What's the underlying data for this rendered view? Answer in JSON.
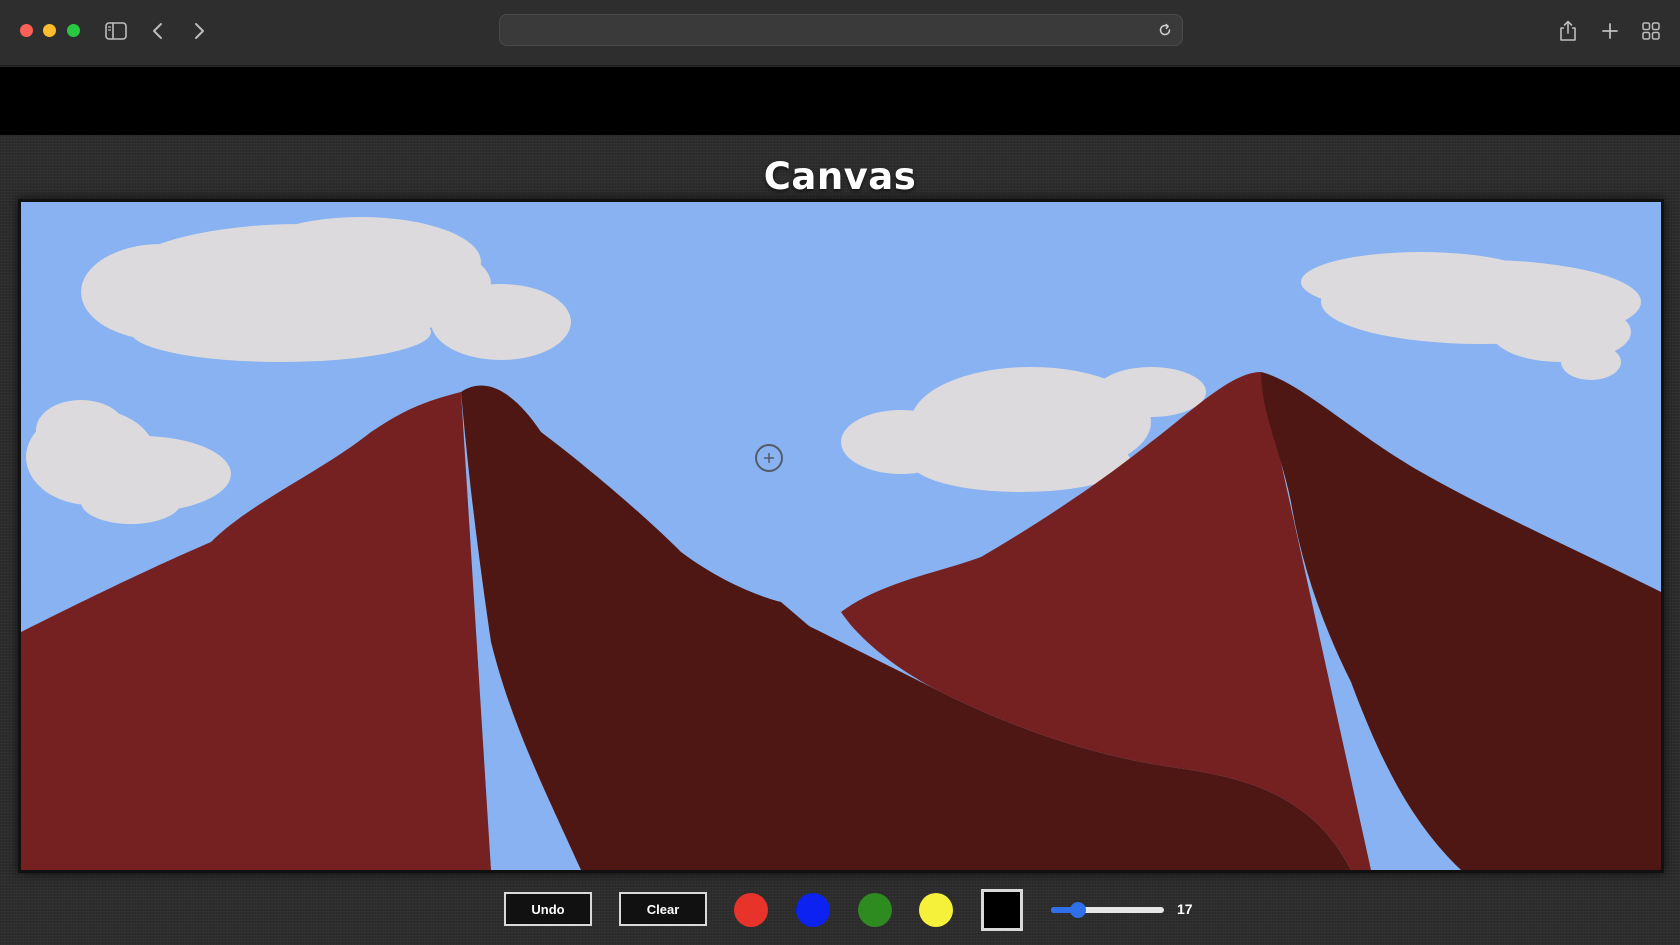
{
  "browser": {
    "address_text": "",
    "icons": {
      "sidebar": "sidebar-toggle-icon",
      "back": "chevron-left-icon",
      "forward": "chevron-right-icon",
      "reload": "reload-icon",
      "share": "share-icon",
      "new_tab": "plus-icon",
      "tab_overview": "grid-icon"
    }
  },
  "page": {
    "title": "Canvas"
  },
  "canvas": {
    "colors": {
      "sky": "#88b2f2",
      "cloud": "#dcdadc",
      "mountain_light": "#762121",
      "mountain_dark": "#4f1714"
    },
    "cursor_icon": "crosshair-circle-icon"
  },
  "toolbar": {
    "undo_label": "Undo",
    "clear_label": "Clear",
    "swatches": [
      {
        "name": "red",
        "color": "#e8332b"
      },
      {
        "name": "blue",
        "color": "#0b22f0"
      },
      {
        "name": "green",
        "color": "#2e8b1f"
      },
      {
        "name": "yellow",
        "color": "#f5f03a"
      }
    ],
    "selected_color": "#000000",
    "brush_size": "17",
    "brush_size_fraction": 0.2
  }
}
